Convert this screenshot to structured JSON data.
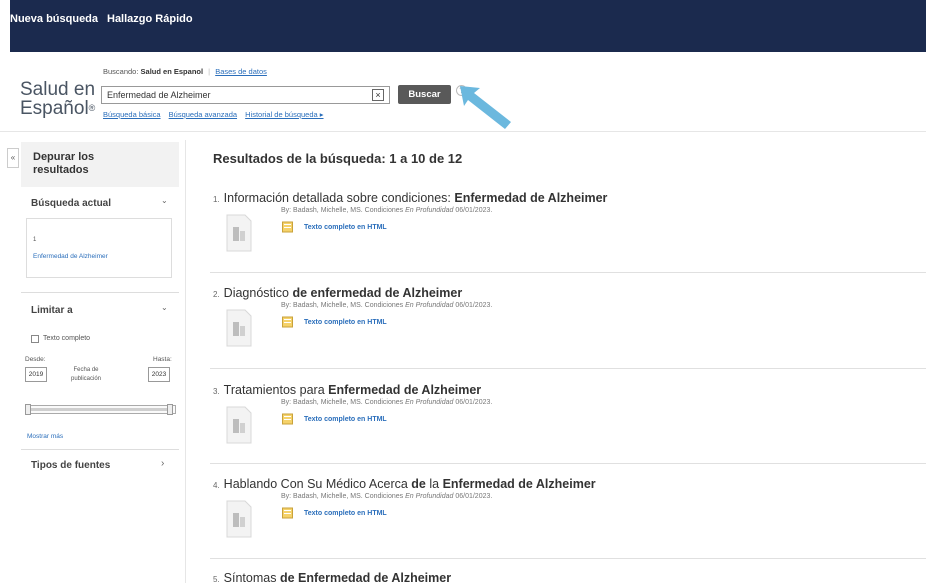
{
  "topbar": {
    "new_search": "Nueva búsqueda",
    "quick_find": "Hallazgo Rápido"
  },
  "logo": {
    "line1": "Salud en",
    "line2": "Español",
    "tm": "®"
  },
  "search": {
    "searching_prefix": "Buscando:",
    "database": "Salud en Espanol",
    "choose_db": "Bases de datos",
    "value": "Enfermedad de Alzheimer",
    "clear": "×",
    "button": "Buscar",
    "help": "?",
    "links": [
      "Búsqueda básica",
      "Búsqueda avanzada",
      "Historial de búsqueda ▸"
    ]
  },
  "sidebar": {
    "collapse": "«",
    "refine_title": "Depurar los resultados",
    "current_title": "Búsqueda actual",
    "current_number": "1",
    "current_term": "Enfermedad de Alzheimer",
    "limit_title": "Limitar a",
    "fulltext_label": "Texto completo",
    "from_label": "Desde:",
    "to_label": "Hasta:",
    "from_year": "2019",
    "to_year": "2023",
    "pub_label_1": "Fecha de",
    "pub_label_2": "publicación",
    "show_more": "Mostrar más",
    "source_types": "Tipos de fuentes",
    "chevron_down": "⌄",
    "chevron_right": "›"
  },
  "results": {
    "heading": "Resultados de la búsqueda: 1 a 10 de 12",
    "fulltext_link": "Texto completo en HTML",
    "items": [
      {
        "num": "1.",
        "plain": "Información detallada sobre condiciones: ",
        "bold": "Enfermedad de Alzheimer",
        "tail": "",
        "authors": "By: Badash, Michelle, MS. Condiciones ",
        "source": "En Profundidad",
        "date": " 06/01/2023."
      },
      {
        "num": "2.",
        "plain": "Diagnóstico ",
        "bold": "de enfermedad de Alzheimer",
        "tail": "",
        "authors": "By: Badash, Michelle, MS. Condiciones ",
        "source": "En Profundidad",
        "date": " 06/01/2023."
      },
      {
        "num": "3.",
        "plain": "Tratamientos para ",
        "bold": "Enfermedad de Alzheimer",
        "tail": "",
        "authors": "By: Badash, Michelle, MS. Condiciones ",
        "source": "En Profundidad",
        "date": " 06/01/2023."
      },
      {
        "num": "4.",
        "plain": "Hablando Con Su Médico Acerca ",
        "bold": "de",
        "tail": " la ",
        "bold2": "Enfermedad de Alzheimer",
        "authors": "By: Badash, Michelle, MS. Condiciones ",
        "source": "En Profundidad",
        "date": " 06/01/2023."
      },
      {
        "num": "5.",
        "plain": "Síntomas ",
        "bold": "de Enfermedad de Alzheimer",
        "tail": ""
      }
    ]
  },
  "colors": {
    "topbar": "#1b2a4e",
    "link": "#2a6ebb",
    "button": "#595959",
    "arrow": "#6bb8de"
  },
  "icons": [
    "clear-icon",
    "help-icon",
    "pointer-arrow-icon",
    "document-thumbnail-icon",
    "html-fulltext-icon",
    "chevron-down-icon",
    "chevron-right-icon",
    "collapse-icon"
  ]
}
